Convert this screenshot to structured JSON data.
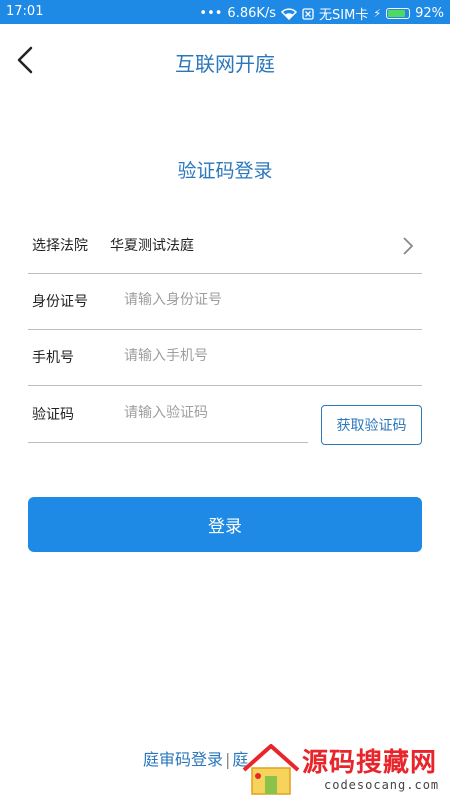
{
  "status_bar": {
    "time": "17:01",
    "network_speed": "6.86K/s",
    "sim": "无SIM卡",
    "battery_level": 0.92,
    "battery_text": "92%"
  },
  "header": {
    "title": "互联网开庭"
  },
  "subtitle": "验证码登录",
  "form": {
    "court": {
      "label": "选择法院",
      "value": "华夏测试法庭"
    },
    "id_card": {
      "label": "身份证号",
      "placeholder": "请输入身份证号"
    },
    "phone": {
      "label": "手机号",
      "placeholder": "请输入手机号"
    },
    "code": {
      "label": "验证码",
      "placeholder": "请输入验证码"
    },
    "get_code_label": "获取验证码"
  },
  "login_label": "登录",
  "bottom_links": {
    "court_code_login": "庭审码登录",
    "separator": "|",
    "partial": "庭"
  },
  "watermark": {
    "text": "源码搜藏网",
    "url": "codesocang.com"
  },
  "colors": {
    "primary": "#1e8ae6",
    "title": "#2b77bc",
    "watermark": "#e8252b"
  }
}
